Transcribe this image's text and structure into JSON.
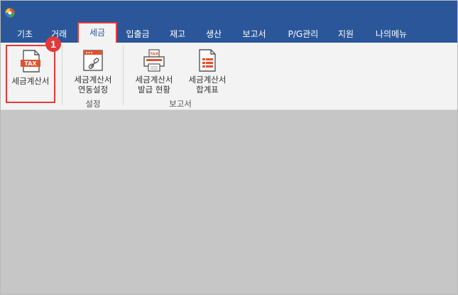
{
  "app": {
    "logo_icon": "app-logo-icon"
  },
  "menu": {
    "tabs": [
      {
        "label": "기초"
      },
      {
        "label": "거래"
      },
      {
        "label": "세금"
      },
      {
        "label": "입출금"
      },
      {
        "label": "재고"
      },
      {
        "label": "생산"
      },
      {
        "label": "보고서"
      },
      {
        "label": "P/G관리"
      },
      {
        "label": "지원"
      },
      {
        "label": "나의메뉴"
      }
    ],
    "active": "세금"
  },
  "ribbon": {
    "buttons": {
      "tax_invoice": {
        "label": "세금계산서",
        "icon": "tax-document-icon",
        "icon_text": "TAX"
      },
      "tax_invoice_link": {
        "line1": "세금계산서",
        "line2": "연동설정",
        "icon": "link-document-icon"
      },
      "issue_status": {
        "line1": "세금계산서",
        "line2": "발급 현황",
        "icon": "tax-printer-icon",
        "icon_text": "TAX"
      },
      "summary_table": {
        "line1": "세금계산서",
        "line2": "합계표",
        "icon": "summary-document-icon"
      }
    },
    "groups": {
      "settings": "설정",
      "reports": "보고서"
    }
  },
  "annotation": {
    "step": "1"
  },
  "colors": {
    "titlebar": "#2b579a",
    "highlight": "#e03a3a",
    "icon_accent": "#e0522e",
    "workspace": "#c6c6c6"
  }
}
